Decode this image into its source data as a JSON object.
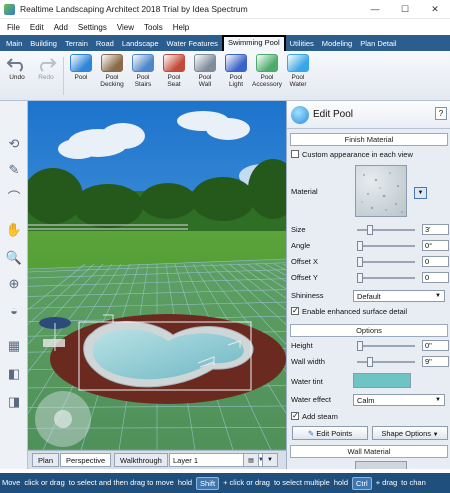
{
  "window": {
    "title": "Realtime Landscaping Architect 2018 Trial by Idea Spectrum",
    "controls": [
      "—",
      "☐",
      "✕"
    ]
  },
  "menu": [
    "File",
    "Edit",
    "Add",
    "Settings",
    "View",
    "Tools",
    "Help"
  ],
  "ribbon_tabs": [
    {
      "label": "Main"
    },
    {
      "label": "Building"
    },
    {
      "label": "Terrain"
    },
    {
      "label": "Road"
    },
    {
      "label": "Landscape"
    },
    {
      "label": "Water Features"
    },
    {
      "label": "Swimming Pool",
      "active": true
    },
    {
      "label": "Utilities"
    },
    {
      "label": "Modeling"
    },
    {
      "label": "Plan Detail"
    }
  ],
  "toolbar": {
    "undo": "Undo",
    "redo": "Redo",
    "tools": [
      {
        "label": "Pool",
        "icon": "pool-icon",
        "color": "#2f86d8"
      },
      {
        "label": "Pool\nDecking",
        "icon": "decking-icon",
        "color": "#8a6a48"
      },
      {
        "label": "Pool\nStairs",
        "icon": "stairs-icon",
        "color": "#4d86c9"
      },
      {
        "label": "Pool\nSeat",
        "icon": "seat-icon",
        "color": "#c24a3a"
      },
      {
        "label": "Pool\nWall",
        "icon": "wall-icon",
        "color": "#7e8c9c"
      },
      {
        "label": "Pool\nLight",
        "icon": "light-icon",
        "color": "#3b62c9"
      },
      {
        "label": "Pool\nAccessory",
        "icon": "accessory-icon",
        "color": "#4caa6a"
      },
      {
        "label": "Pool\nWater",
        "icon": "water-icon",
        "color": "#39a6e6"
      }
    ]
  },
  "left_tools": [
    {
      "name": "select-arrow-icon",
      "glyph": "↖",
      "selected": true
    },
    {
      "name": "rotate-icon",
      "glyph": "⟲"
    },
    {
      "name": "pencil-icon",
      "glyph": "✎"
    },
    {
      "name": "curve-icon",
      "glyph": "⌒"
    },
    {
      "name": "hand-pan-icon",
      "glyph": "✋"
    },
    {
      "name": "zoom-icon",
      "glyph": "🔍"
    },
    {
      "name": "zoom-extents-icon",
      "glyph": "⊕"
    },
    {
      "name": "orbit-icon",
      "glyph": "◒"
    },
    {
      "name": "grid-toggle-icon",
      "glyph": "▦"
    },
    {
      "name": "snap-icon",
      "glyph": "◧"
    },
    {
      "name": "eraser-icon",
      "glyph": "◨"
    }
  ],
  "viewport_tabs": [
    {
      "label": "Plan"
    },
    {
      "label": "Perspective",
      "active": true
    },
    {
      "label": "Walkthrough"
    }
  ],
  "layer_select": "Layer 1",
  "panel": {
    "title": "Edit Pool",
    "help": "?",
    "finish_material": {
      "header": "Finish Material",
      "custom_appearance": {
        "label": "Custom appearance in each view",
        "checked": false
      },
      "material_label": "Material",
      "sliders": [
        {
          "label": "Size",
          "value": "3'",
          "level": 0.2
        },
        {
          "label": "Angle",
          "value": "0°",
          "level": 0.0
        },
        {
          "label": "Offset X",
          "value": "0",
          "level": 0.0
        },
        {
          "label": "Offset Y",
          "value": "0",
          "level": 0.0
        }
      ],
      "shininess_label": "Shininess",
      "shininess_value": "Default",
      "enhanced_detail": {
        "label": "Enable enhanced surface detail",
        "checked": true
      }
    },
    "options": {
      "header": "Options",
      "height": {
        "label": "Height",
        "value": "0\"",
        "level": 0.0
      },
      "wall_width": {
        "label": "Wall width",
        "value": "9\"",
        "level": 0.2
      },
      "water_tint_label": "Water tint",
      "water_tint_color": "#6ec3c4",
      "water_effect_label": "Water effect",
      "water_effect_value": "Calm",
      "add_steam": {
        "label": "Add steam",
        "checked": true
      },
      "edit_points": "Edit Points",
      "shape_options": "Shape Options"
    },
    "wall_material": {
      "header": "Wall Material"
    }
  },
  "status": {
    "parts": [
      "Move",
      "click or drag",
      "to select and then drag to move",
      "hold",
      "Shift",
      "+ click or drag",
      "to select multiple",
      "hold",
      "Ctrl",
      "+ drag",
      "to chan"
    ]
  },
  "colors": {
    "ribbon": "#2b5d8e",
    "status": "#1f4f7c",
    "sky": "#2f86d6",
    "grass": "#4f9a32",
    "grid": "#7fb0c8"
  }
}
